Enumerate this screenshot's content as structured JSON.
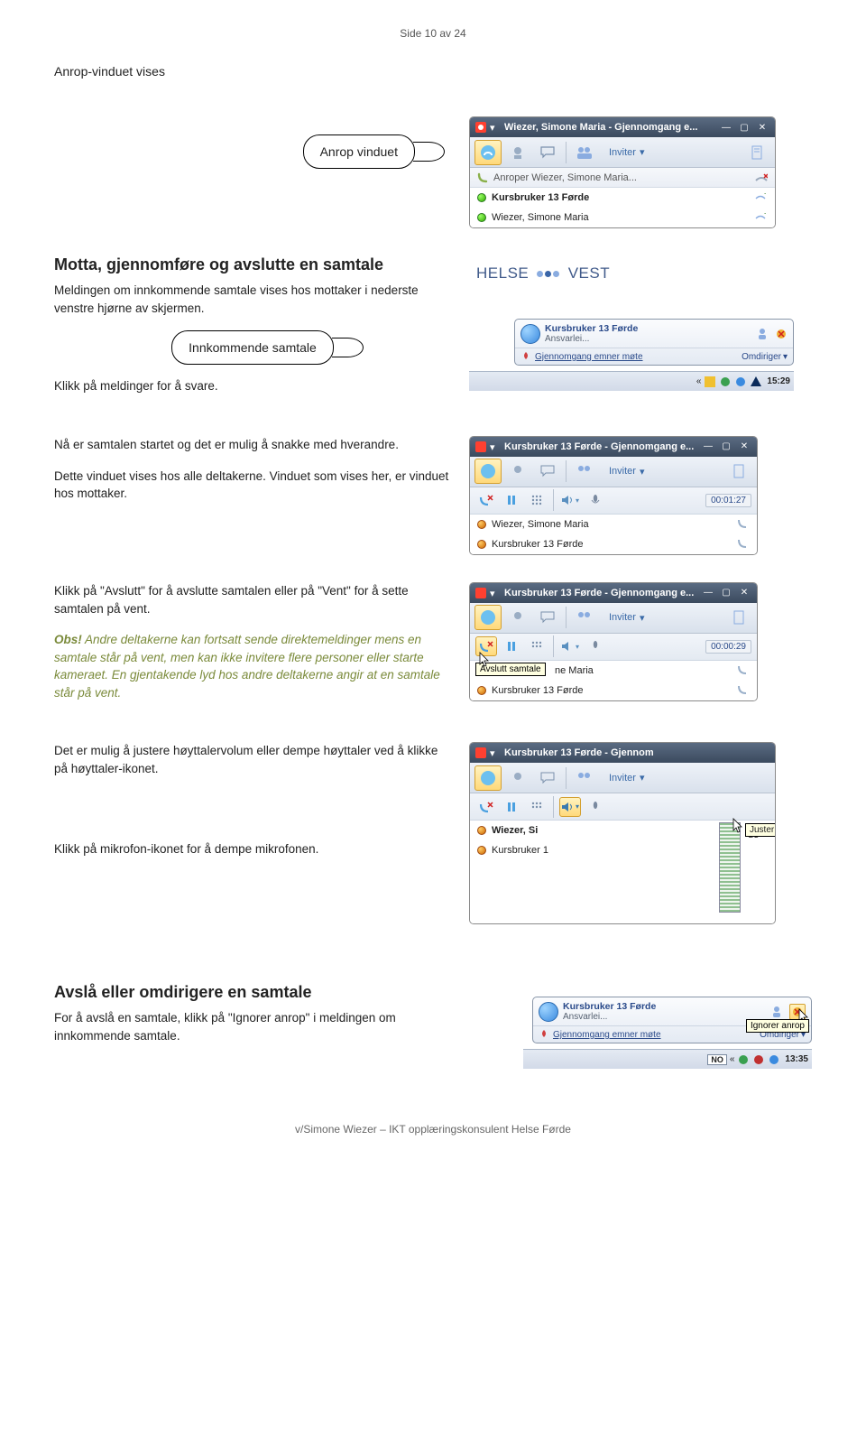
{
  "page_number": "Side 10 av 24",
  "section1_title": "Anrop-vinduet vises",
  "callout1": "Anrop vinduet",
  "callout2": "Innkommende samtale",
  "section2_title": "Motta, gjennomføre og avslutte en samtale",
  "p1": "Meldingen om innkommende samtale vises hos mottaker i nederste venstre hjørne av skjermen.",
  "p2": "Klikk på meldinger for å svare.",
  "p3": "Nå er samtalen startet og det er mulig å snakke med hverandre.",
  "p4": "Dette vinduet vises hos alle deltakerne. Vinduet som vises her, er vinduet hos mottaker.",
  "p5": "Klikk på \"Avslutt\" for å avslutte samtalen eller på \"Vent\" for å sette samtalen på vent.",
  "obs_label": "Obs!",
  "obs_text": " Andre deltakerne kan fortsatt sende direktemeldinger mens en samtale står på vent, men kan ikke invitere flere personer eller starte kameraet. En gjentakende lyd hos andre deltakerne angir at en samtale står på vent.",
  "p6": "Det er mulig å justere høyttalervolum eller dempe høyttaler ved å klikke på høyttaler-ikonet.",
  "p7": "Klikk på mikrofon-ikonet for å dempe mikrofonen.",
  "section3_title": "Avslå eller omdirigere en samtale",
  "p8": "For å avslå en samtale, klikk på \"Ignorer anrop\" i meldingen om innkommende samtale.",
  "footer": "v/Simone Wiezer – IKT opplæringskonsulent Helse Førde",
  "ocs1": {
    "title": "Wiezer, Simone Maria - Gjennomgang e...",
    "inviter": "Inviter",
    "status": "Anroper Wiezer, Simone Maria...",
    "participants": [
      {
        "name": "Kursbruker 13 Førde",
        "presence": "green",
        "bold": true
      },
      {
        "name": "Wiezer, Simone Maria",
        "presence": "green",
        "bold": false
      }
    ]
  },
  "hv": {
    "brand_left": "HELSE",
    "brand_right": "VEST",
    "toast": {
      "name": "Kursbruker 13 Førde",
      "sub": "Ansvarlei...",
      "link": "Gjennomgang emner møte",
      "redirect": "Omdiriger"
    },
    "tray_time": "15:29"
  },
  "ocs2": {
    "title": "Kursbruker 13 Førde - Gjennomgang e...",
    "inviter": "Inviter",
    "timer": "00:01:27",
    "participants": [
      {
        "name": "Wiezer, Simone Maria",
        "presence": "orange"
      },
      {
        "name": "Kursbruker 13 Førde",
        "presence": "orange"
      }
    ]
  },
  "ocs3": {
    "title": "Kursbruker 13 Førde - Gjennomgang e...",
    "inviter": "Inviter",
    "timer": "00:00:29",
    "tooltip": "Avslutt samtale",
    "row1_suffix": "ne Maria",
    "participants": [
      {
        "name": "Kursbruker 13 Førde",
        "presence": "orange"
      }
    ]
  },
  "ocs4": {
    "title": "Kursbruker 13 Førde - Gjennom",
    "inviter": "Inviter",
    "vol_tooltip": "Juster høyttalervolum",
    "row1_prefix": "Wiezer, Si",
    "row2_prefix": "Kursbruker 1",
    "row2_suffix": "de"
  },
  "toast2": {
    "name": "Kursbruker 13 Førde",
    "sub": "Ansvarlei...",
    "link": "Gjennomgang emner møte",
    "redirect": "Omdiriger",
    "ignore_tip": "Ignorer anrop",
    "tray_lang": "NO",
    "tray_time": "13:35"
  }
}
